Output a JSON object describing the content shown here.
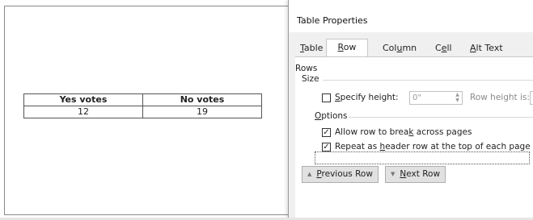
{
  "document": {
    "table": {
      "headers": [
        "Yes votes",
        "No votes"
      ],
      "rows": [
        [
          "12",
          "19"
        ]
      ]
    }
  },
  "dialog": {
    "title": "Table Properties",
    "tabs": [
      {
        "label": "Table",
        "active": false
      },
      {
        "label": "Row",
        "active": true
      },
      {
        "label": "Column",
        "active": false
      },
      {
        "label": "Cell",
        "active": false
      },
      {
        "label": "Alt Text",
        "active": false
      }
    ],
    "rows_section": {
      "heading": "Rows",
      "size_label": "Size",
      "specify_height_label": "Specify height:",
      "specify_height_checked": false,
      "height_value": "0\"",
      "row_height_is_label": "Row height is:",
      "options_label": "Options",
      "allow_break_label": "Allow row to break across pages",
      "allow_break_checked": true,
      "repeat_header_label": "Repeat as header row at the top of each page",
      "repeat_header_checked": true
    },
    "buttons": {
      "previous_row": "Previous Row",
      "next_row": "Next Row"
    }
  }
}
